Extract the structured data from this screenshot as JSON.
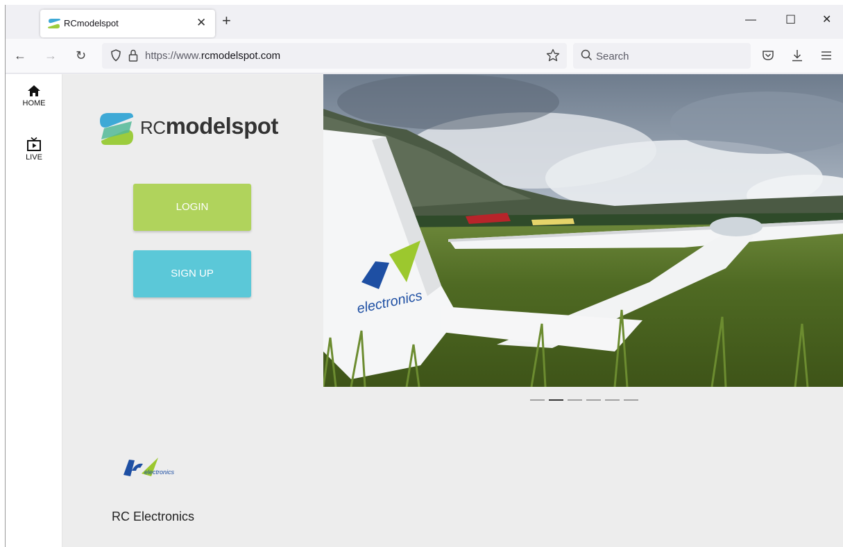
{
  "browser": {
    "tab_title": "RCmodelspot",
    "url_prefix": "https://www.",
    "url_domain": "rcmodelspot.com",
    "search_placeholder": "Search"
  },
  "sidebar": {
    "items": [
      {
        "label": "HOME",
        "icon": "home-icon"
      },
      {
        "label": "LIVE",
        "icon": "tv-icon"
      }
    ]
  },
  "logo": {
    "prefix": "RC",
    "name": "modelspot"
  },
  "auth": {
    "login_label": "LOGIN",
    "signup_label": "SIGN UP"
  },
  "carousel": {
    "slide_count": 6,
    "active_index": 1
  },
  "sponsor": {
    "name": "RC Electronics"
  },
  "colors": {
    "login_button": "#b0d35c",
    "signup_button": "#5bc8d8",
    "logo_blue": "#3ea9d6",
    "logo_green": "#9ccc3d"
  }
}
